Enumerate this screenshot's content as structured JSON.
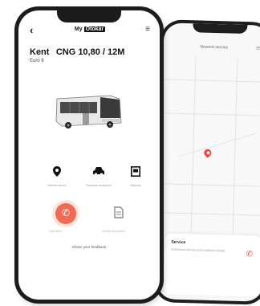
{
  "front_phone": {
    "header": {
      "title_prefix": "My",
      "title_brand": "Otokar",
      "back_icon": "back-arrow-icon",
      "menu_icon": "menu-icon"
    },
    "vehicle": {
      "model": "Kent",
      "separator": ":",
      "spec": "CNG 10,80 / 12M",
      "sub": "Euro 6"
    },
    "tools": [
      {
        "icon": "location-pin-icon",
        "label": "Nearest service"
      },
      {
        "icon": "car-icon",
        "label": "Roadside assistance"
      },
      {
        "icon": "document-icon",
        "label": "Manuals"
      }
    ],
    "actions": [
      {
        "icon": "phone-icon",
        "label": "Call center"
      },
      {
        "icon": "file-icon",
        "label": "Service documents"
      }
    ],
    "footer_link": "Share your feedback"
  },
  "back_phone": {
    "header": {
      "title": "Nearest service",
      "menu_icon": "menu-icon"
    },
    "card": {
      "heading": "Service",
      "text": "Authorized service point address details",
      "call_icon": "phone-icon"
    },
    "map_pin": "map-pin-icon"
  },
  "colors": {
    "accent": "#f06b52",
    "map_pin": "#e94335"
  }
}
